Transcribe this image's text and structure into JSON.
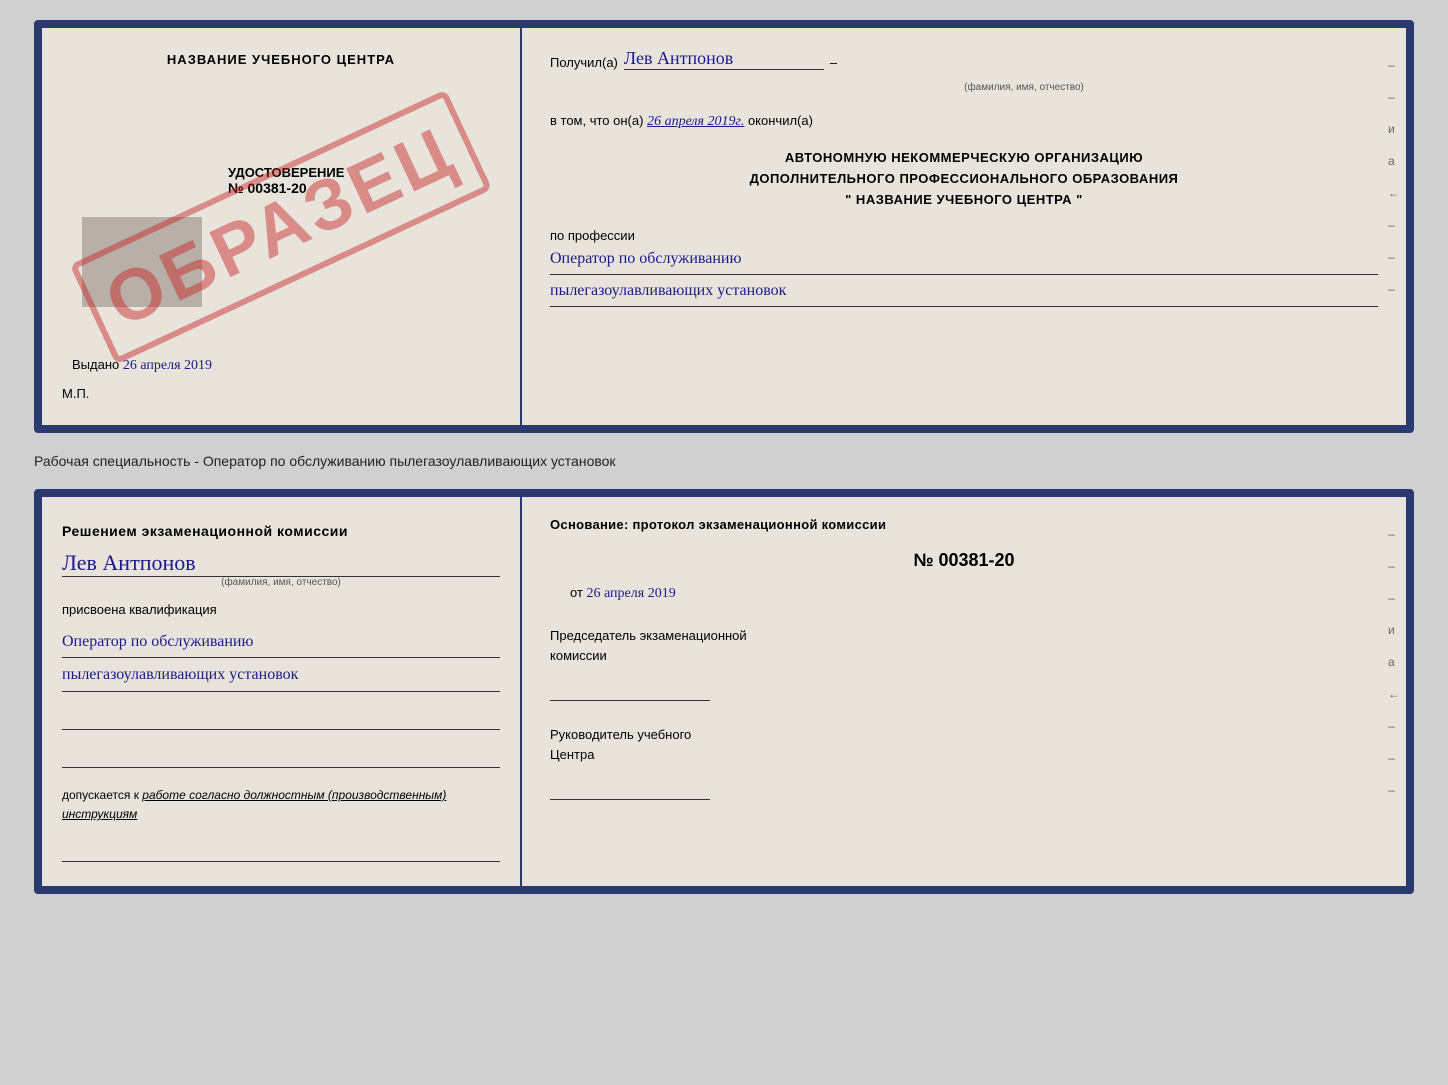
{
  "top_doc": {
    "left": {
      "school_name": "НАЗВАНИЕ УЧЕБНОГО ЦЕНТРА",
      "watermark": "ОБРАЗЕЦ",
      "gray_box_label": "",
      "cert_label": "УДОСТОВЕРЕНИЕ",
      "cert_number": "№ 00381-20",
      "issued_label": "Выдано",
      "issued_date": "26 апреля 2019",
      "mp_label": "М.П."
    },
    "right": {
      "received_label": "Получил(а)",
      "person_name": "Лев Антпонов",
      "fio_subtext": "(фамилия, имя, отчество)",
      "dash": "–",
      "fact_label": "в том, что он(а)",
      "fact_date": "26 апреля 2019г.",
      "finished_label": "окончил(а)",
      "org_line1": "АВТОНОМНУЮ НЕКОММЕРЧЕСКУЮ ОРГАНИЗАЦИЮ",
      "org_line2": "ДОПОЛНИТЕЛЬНОГО ПРОФЕССИОНАЛЬНОГО ОБРАЗОВАНИЯ",
      "org_line3": "\"   НАЗВАНИЕ УЧЕБНОГО ЦЕНТРА   \"",
      "profession_label": "по профессии",
      "profession_line1": "Оператор по обслуживанию",
      "profession_line2": "пылегазоулавливающих установок",
      "side_marks": [
        "–",
        "–",
        "а",
        "←",
        "–",
        "–",
        "–"
      ]
    }
  },
  "middle": {
    "label": "Рабочая специальность - Оператор по обслуживанию пылегазоулавливающих установок"
  },
  "bottom_doc": {
    "left": {
      "commission_text": "Решением экзаменационной комиссии",
      "person_name": "Лев Антпонов",
      "fio_subtext": "(фамилия, имя, отчество)",
      "assigned_label": "присвоена квалификация",
      "qual_line1": "Оператор по обслуживанию",
      "qual_line2": "пылегазоулавливающих установок",
      "blank_lines": [
        "",
        ""
      ],
      "allowed_prefix": "допускается к",
      "allowed_text": "работе согласно должностным (производственным) инструкциям",
      "blank_line_bottom": ""
    },
    "right": {
      "basis_label": "Основание: протокол экзаменационной комиссии",
      "protocol_number": "№ 00381-20",
      "date_prefix": "от",
      "date_value": "26 апреля 2019",
      "chairman_line1": "Председатель экзаменационной",
      "chairman_line2": "комиссии",
      "director_line1": "Руководитель учебного",
      "director_line2": "Центра",
      "side_marks": [
        "–",
        "–",
        "–",
        "и",
        "а",
        "←",
        "–",
        "–",
        "–"
      ]
    }
  }
}
